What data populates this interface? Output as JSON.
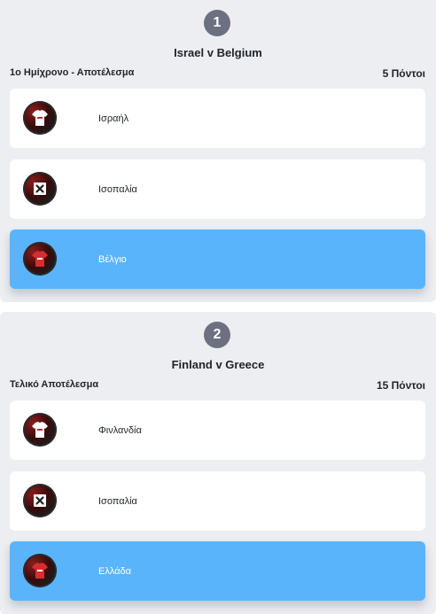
{
  "matches": [
    {
      "number": "1",
      "title": "Israel v Belgium",
      "market": "1ο Ημίχρονο - Αποτέλεσμα",
      "points": "5 Πόντοι",
      "options": [
        {
          "label": "Ισραήλ",
          "icon": "white-shirt-icon",
          "selected": false
        },
        {
          "label": "Ισοπαλία",
          "icon": "draw-x-icon",
          "selected": false
        },
        {
          "label": "Βέλγιο",
          "icon": "red-shirt-icon",
          "selected": true
        }
      ]
    },
    {
      "number": "2",
      "title": "Finland v Greece",
      "market": "Τελικό Αποτέλεσμα",
      "points": "15 Πόντοι",
      "options": [
        {
          "label": "Φινλανδία",
          "icon": "white-shirt-icon",
          "selected": false
        },
        {
          "label": "Ισοπαλία",
          "icon": "draw-x-icon",
          "selected": false
        },
        {
          "label": "Ελλάδα",
          "icon": "red-shirt-icon",
          "selected": true
        }
      ]
    }
  ],
  "colors": {
    "card_bg": "#eceef1",
    "number_badge": "#6d7080",
    "selected_option": "#5ab4fb",
    "option_bg": "#ffffff"
  }
}
